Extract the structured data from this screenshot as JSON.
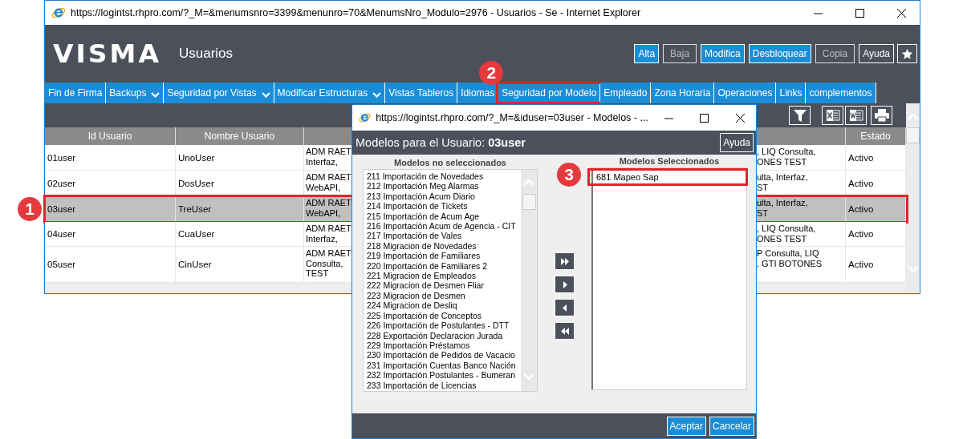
{
  "browser_window": {
    "title": "https://logintst.rhpro.com/?_M=&menumsnro=3399&menunro=70&MenumsNro_Modulo=2976 - Usuarios - Se - Internet Explorer"
  },
  "header": {
    "logo": "VISMA",
    "title": "Usuarios",
    "buttons": [
      {
        "label": "Alta",
        "kind": "primary",
        "disabled": false
      },
      {
        "label": "Baja",
        "kind": "outline",
        "disabled": true
      },
      {
        "label": "Modifica",
        "kind": "primary",
        "disabled": false
      },
      {
        "label": "Desbloquear",
        "kind": "primary",
        "disabled": false
      },
      {
        "label": "Copia",
        "kind": "outline",
        "disabled": true
      },
      {
        "label": "Ayuda",
        "kind": "outline",
        "disabled": false
      }
    ]
  },
  "menu": [
    {
      "label": "Fin de Firma",
      "dropdown": false,
      "highlighted": false
    },
    {
      "label": "Backups",
      "dropdown": true,
      "highlighted": false
    },
    {
      "label": "Seguridad por Vistas",
      "dropdown": true,
      "highlighted": false
    },
    {
      "label": "Modificar Estructuras",
      "dropdown": true,
      "highlighted": false
    },
    {
      "label": "Vistas Tableros",
      "dropdown": false,
      "highlighted": false
    },
    {
      "label": "Idiomas",
      "dropdown": false,
      "highlighted": false
    },
    {
      "label": "Seguridad por Modelo",
      "dropdown": false,
      "highlighted": true,
      "callout": "2"
    },
    {
      "label": "Empleado",
      "dropdown": false,
      "highlighted": false
    },
    {
      "label": "Zona Horaria",
      "dropdown": false,
      "highlighted": false
    },
    {
      "label": "Operaciones",
      "dropdown": false,
      "highlighted": false
    },
    {
      "label": "Links",
      "dropdown": false,
      "highlighted": false
    },
    {
      "label": "complementos",
      "dropdown": false,
      "highlighted": false
    }
  ],
  "table": {
    "columns": [
      "Id Usuario",
      "Nombre Usuario",
      "Estado"
    ],
    "rows": [
      {
        "id": "01user",
        "name": "UnoUser",
        "column_3_left": [
          "ADM RAET",
          "Interfaz,"
        ],
        "column_3_right": [
          ", LIQ Consulta,",
          "ONES TEST"
        ],
        "estado": "Activo",
        "selected": false,
        "highlighted": false
      },
      {
        "id": "02user",
        "name": "DosUser",
        "column_3_left": [
          "ADM RAET",
          "WebAPI,"
        ],
        "column_3_right": [
          "ulta, Interfaz,",
          "ST"
        ],
        "estado": "Activo",
        "selected": false,
        "highlighted": false
      },
      {
        "id": "03user",
        "name": "TreUser",
        "column_3_left": [
          "ADM RAET",
          "WebAPI,"
        ],
        "column_3_right": [
          "ulta, Interfaz,",
          "ST"
        ],
        "estado": "Activo",
        "selected": true,
        "highlighted": true,
        "callout": "1"
      },
      {
        "id": "04user",
        "name": "CuaUser",
        "column_3_left": [
          "ADM RAET",
          "Interfaz,"
        ],
        "column_3_right": [
          ", LIQ Consulta,",
          "ONES TEST"
        ],
        "estado": "Activo",
        "selected": false,
        "highlighted": false
      },
      {
        "id": "05user",
        "name": "CinUser",
        "column_3_left": [
          "ADM RAET",
          "Consulta,",
          "TEST"
        ],
        "column_3_right": [
          "P Consulta, LIQ",
          ". GTI BOTONES"
        ],
        "estado": "Activo",
        "selected": false,
        "highlighted": false
      }
    ]
  },
  "dialog": {
    "title": "https://logintst.rhpro.com/?_M=&iduser=03user - Modelos - ...",
    "heading": "Modelos para el Usuario: **03user**",
    "help_button": "Ayuda",
    "available": {
      "label": "Modelos no seleccionados",
      "items": [
        "211 Importación de Novedades",
        "212 Importación Meg Alarmas",
        "213 Importación Acum Diario",
        "214 Importación de Tickets",
        "215 Importación de Acum Age",
        "216 Importación Acum de Agencia - CIT",
        "217 Importación de Vales",
        "218 Migracion de Novedades",
        "219 Importación de Familiares",
        "220 Importación de Familiares 2",
        "221 Migracion de Empleados",
        "222 Migracion de Desmen Fliar",
        "223 Migracion de Desmen",
        "224 Migracion de Desliq",
        "225 Importación de Conceptos",
        "226 Importación de Postulantes - DTT",
        "228 Exportación Declaracion Jurada",
        "229 Importación Préstamos",
        "230 Importación de Pedidos de Vacacio",
        "231 Importación Cuentas Banco Nación",
        "232 Importación Postulantes - Bumeran",
        "233 Importación de Licencias"
      ]
    },
    "chosen": {
      "label": "Modelos Seleccionados",
      "items": [
        {
          "label": "681 Mapeo Sap",
          "highlighted": true,
          "callout": "3"
        }
      ]
    },
    "buttons": [
      {
        "label": "Aceptar"
      },
      {
        "label": "Cancelar"
      }
    ]
  }
}
